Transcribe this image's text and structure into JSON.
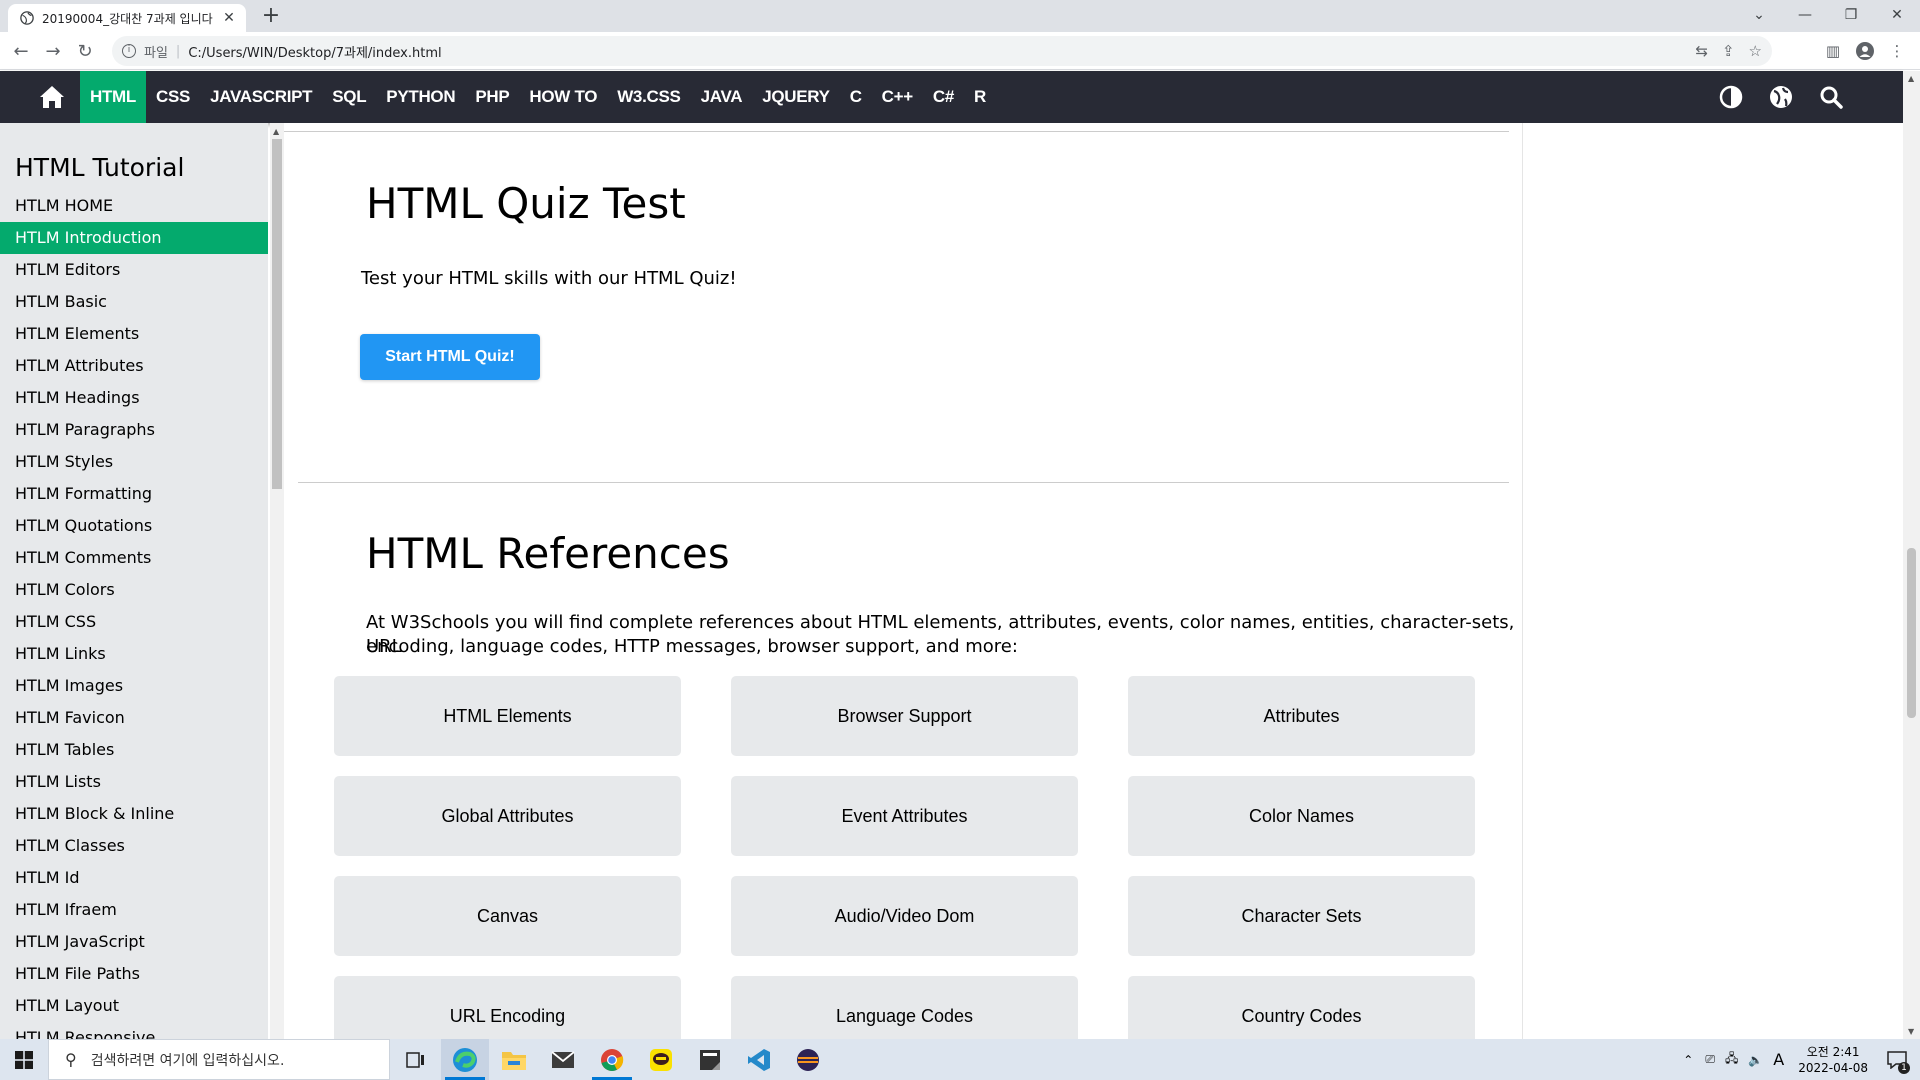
{
  "browser": {
    "tab_title": "20190004_강대찬 7과제 입니다",
    "new_tab_label": "+",
    "url_scheme": "파일",
    "url": "C:/Users/WIN/Desktop/7과제/index.html"
  },
  "topnav": {
    "items": [
      "HTML",
      "CSS",
      "JAVASCRIPT",
      "SQL",
      "PYTHON",
      "PHP",
      "HOW TO",
      "W3.CSS",
      "JAVA",
      "JQUERY",
      "C",
      "C++",
      "C#",
      "R"
    ],
    "active": "HTML"
  },
  "sidebar": {
    "title": "HTML Tutorial",
    "items": [
      "HTLM HOME",
      "HTLM Introduction",
      "HTLM Editors",
      "HTLM Basic",
      "HTLM Elements",
      "HTLM Attributes",
      "HTLM Headings",
      "HTLM Paragraphs",
      "HTLM Styles",
      "HTLM Formatting",
      "HTLM Quotations",
      "HTLM Comments",
      "HTLM Colors",
      "HTLM CSS",
      "HTLM Links",
      "HTLM Images",
      "HTLM Favicon",
      "HTLM Tables",
      "HTLM Lists",
      "HTLM Block & Inline",
      "HTLM Classes",
      "HTLM Id",
      "HTLM Ifraem",
      "HTLM JavaScript",
      "HTLM File Paths",
      "HTLM Layout",
      "HTLM Responsive"
    ],
    "active_index": 1
  },
  "quiz": {
    "heading": "HTML Quiz Test",
    "text": "Test your HTML skills with our HTML Quiz!",
    "button": "Start HTML Quiz!"
  },
  "references": {
    "heading": "HTML References",
    "text_line1": "At W3Schools you will find complete references about HTML elements, attributes, events, color names, entities, character-sets, URL",
    "text_line2": "encoding, language codes, HTTP messages, browser support, and more:",
    "buttons": [
      "HTML Elements",
      "Browser Support",
      "Attributes",
      "Global Attributes",
      "Event Attributes",
      "Color Names",
      "Canvas",
      "Audio/Video Dom",
      "Character Sets",
      "URL Encoding",
      "Language Codes",
      "Country Codes"
    ]
  },
  "taskbar": {
    "search_placeholder": "검색하려면 여기에 입력하십시오.",
    "ime": "A",
    "time": "오전 2:41",
    "date": "2022-04-08",
    "notification_count": "1"
  },
  "colors": {
    "nav_bg": "#282a35",
    "accent_green": "#04aa6d",
    "quiz_blue": "#2196f3",
    "sidebar_bg": "#e7e9eb"
  }
}
